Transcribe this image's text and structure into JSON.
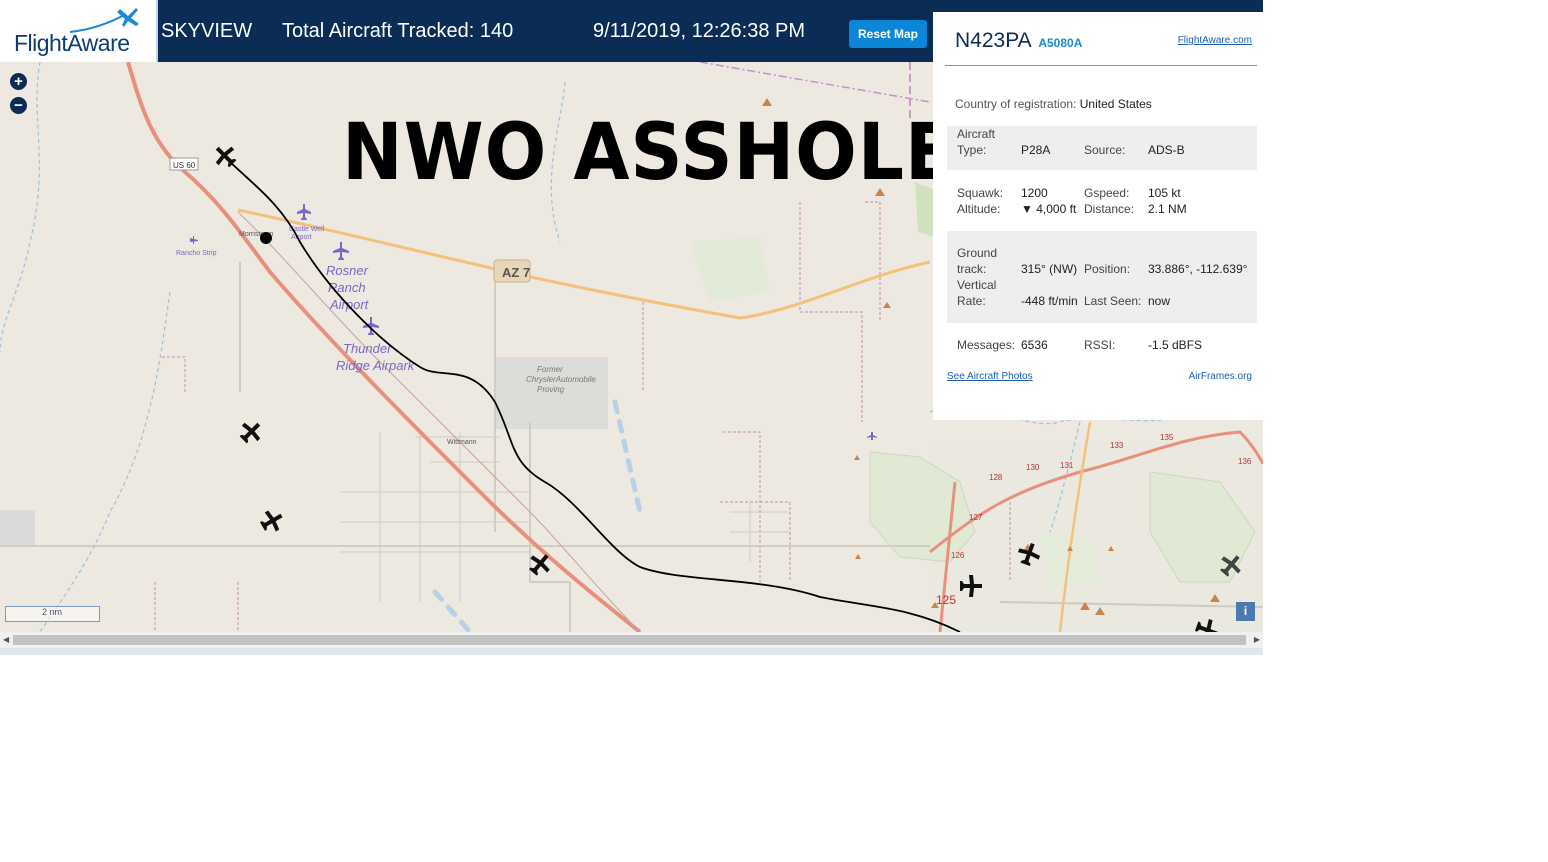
{
  "header": {
    "brand": "FlightAware",
    "app_name": "SKYVIEW",
    "total_label": "Total Aircraft Tracked: 140",
    "datetime": "9/11/2019, 12:26:38 PM",
    "reset_button": "Reset Map"
  },
  "overlay_text": "NWO ASSHOLE",
  "map": {
    "scale_label": "2 nm",
    "info_button": "i",
    "labels": {
      "us60": "US 60",
      "az74": "AZ 7",
      "morristown": "Morristown",
      "castle_well": "Castle Well",
      "airport_small": "Airport",
      "rancho_strip": "Rancho Strip",
      "rosner1": "Rosner",
      "rosner2": "Ranch",
      "rosner3": "Airport",
      "thunder1": "Thunder",
      "thunder2": "Ridge Airpark",
      "former1": "Former",
      "former2": "ChryslerAutomobile",
      "former3": "Proving",
      "wittmann": "Wittmann",
      "r125": "125",
      "r128": "128",
      "r127": "127",
      "r126": "126",
      "r130": "130",
      "r131": "131",
      "r133": "133",
      "r135": "135",
      "r136": "136"
    }
  },
  "panel": {
    "registration": "N423PA",
    "hex": "A5080A",
    "site_link": "FlightAware.com",
    "country_label": "Country of registration:",
    "country_value": "United States",
    "aircraft_type_label1": "Aircraft",
    "aircraft_type_label2": "Type:",
    "aircraft_type": "P28A",
    "source_label": "Source:",
    "source": "ADS-B",
    "squawk_label": "Squawk:",
    "squawk": "1200",
    "gspeed_label": "Gspeed:",
    "gspeed": "105 kt",
    "altitude_label": "Altitude:",
    "altitude": "▼ 4,000 ft",
    "distance_label": "Distance:",
    "distance": "2.1 NM",
    "track_label1": "Ground",
    "track_label2": "track:",
    "track": "315° (NW)",
    "position_label": "Position:",
    "position": "33.886°, -112.639°",
    "vrate_label1": "Vertical",
    "vrate_label2": "Rate:",
    "vrate": "-448 ft/min",
    "last_seen_label": "Last Seen:",
    "last_seen": "now",
    "messages_label": "Messages:",
    "messages": "6536",
    "rssi_label": "RSSI:",
    "rssi": "-1.5 dBFS",
    "photos_link": "See Aircraft Photos",
    "airframes_link": "AirFrames.org"
  },
  "colors": {
    "header_bg": "#0a2c55",
    "accent": "#0c86d6",
    "map_bg": "#ede9e1",
    "highway": "#e8907c",
    "state_route": "#f2c27d"
  },
  "icons": [
    "flightaware-logo-plane",
    "zoom-in-icon",
    "zoom-out-icon",
    "airplane-icon",
    "airport-icon",
    "peak-icon",
    "info-icon"
  ]
}
